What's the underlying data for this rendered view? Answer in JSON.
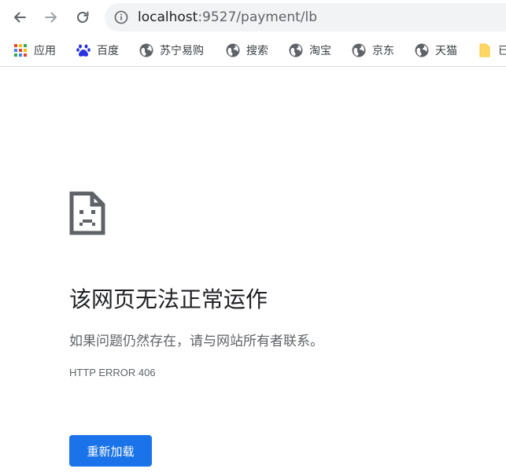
{
  "address_bar": {
    "host": "localhost",
    "port_path": ":9527/payment/lb"
  },
  "bookmarks": [
    {
      "label": "应用",
      "icon": "apps-grid-icon"
    },
    {
      "label": "百度",
      "icon": "baidu-paw-icon"
    },
    {
      "label": "苏宁易购",
      "icon": "globe-icon"
    },
    {
      "label": "搜索",
      "icon": "globe-icon"
    },
    {
      "label": "淘宝",
      "icon": "globe-icon"
    },
    {
      "label": "京东",
      "icon": "globe-icon"
    },
    {
      "label": "天猫",
      "icon": "globe-icon"
    },
    {
      "label": "已",
      "icon": "folder-icon"
    }
  ],
  "error_page": {
    "icon": "sad-page-icon",
    "title": "该网页无法正常运作",
    "description": "如果问题仍然存在，请与网站所有者联系。",
    "error_code": "HTTP ERROR 406",
    "reload_label": "重新加载"
  },
  "colors": {
    "accent": "#1a73e8",
    "text_primary": "#202124",
    "text_secondary": "#5f6368",
    "omnibox_bg": "#f1f3f4"
  }
}
